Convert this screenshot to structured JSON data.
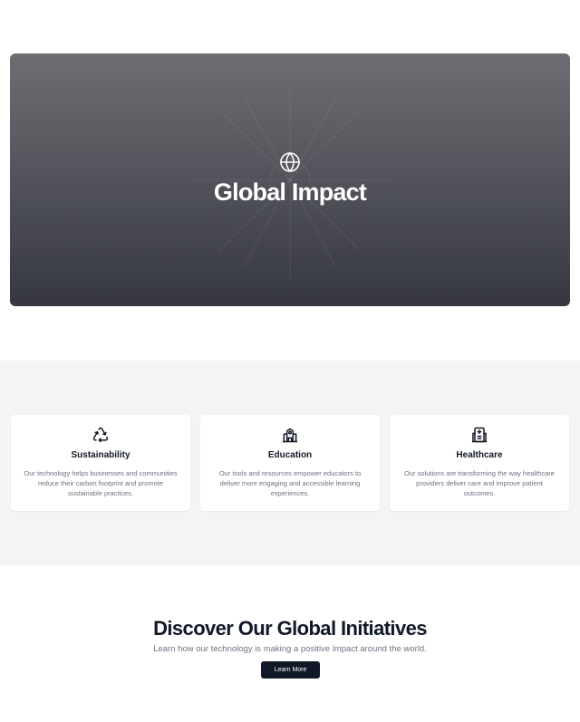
{
  "hero": {
    "title": "Global Impact",
    "icon": "globe-icon",
    "gradient_top": "#6d6e73",
    "gradient_bottom": "#36373f"
  },
  "features": {
    "background": "#f3f4f6",
    "items": [
      {
        "icon": "recycle-icon",
        "title": "Sustainability",
        "text": "Our technology helps businesses and communities reduce their carbon footprint and promote sustainable practices."
      },
      {
        "icon": "school-icon",
        "title": "Education",
        "text": "Our tools and resources empower educators to deliver more engaging and accessible learning experiences."
      },
      {
        "icon": "hospital-icon",
        "title": "Healthcare",
        "text": "Our solutions are transforming the way healthcare providers deliver care and improve patient outcomes."
      }
    ]
  },
  "cta": {
    "title": "Discover Our Global Initiatives",
    "subtitle": "Learn how our technology is making a positive impact around the world.",
    "button_label": "Learn More",
    "button_color": "#111827"
  }
}
